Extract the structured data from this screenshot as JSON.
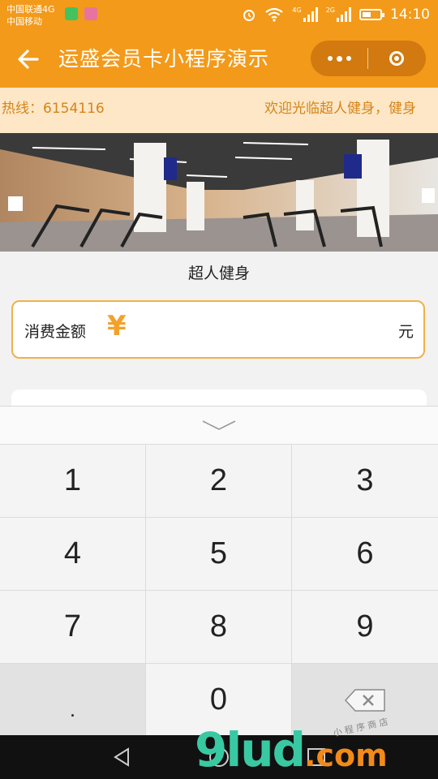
{
  "status_bar": {
    "carrier_1": "中国联通4G",
    "carrier_2": "中国移动",
    "net_tag_1": "4G",
    "net_tag_2": "2G",
    "time": "14:10"
  },
  "nav": {
    "title": "运盛会员卡小程序演示",
    "back_icon": "arrow-left-icon",
    "more_icon": "more-dots-icon",
    "close_icon": "target-circle-icon"
  },
  "notice": {
    "hotline": "热线：6154116",
    "welcome": "欢迎光临超人健身，健身"
  },
  "store": {
    "name": "超人健身"
  },
  "payment": {
    "label": "消费金额",
    "currency_symbol": "¥",
    "value": "",
    "unit": "元"
  },
  "keypad": {
    "keys": [
      "1",
      "2",
      "3",
      "4",
      "5",
      "6",
      "7",
      "8",
      "9",
      ".",
      "0"
    ],
    "delete_icon": "backspace-icon",
    "collapse_icon": "chevron-down-icon"
  },
  "watermark": {
    "brand": "9lud",
    "suffix": ".com",
    "sub": "小 程 序 商 店"
  },
  "colors": {
    "primary": "#f39a1a",
    "notice_bg": "#fde7c7",
    "notice_text": "#d58418",
    "input_border": "#f0b14a"
  }
}
